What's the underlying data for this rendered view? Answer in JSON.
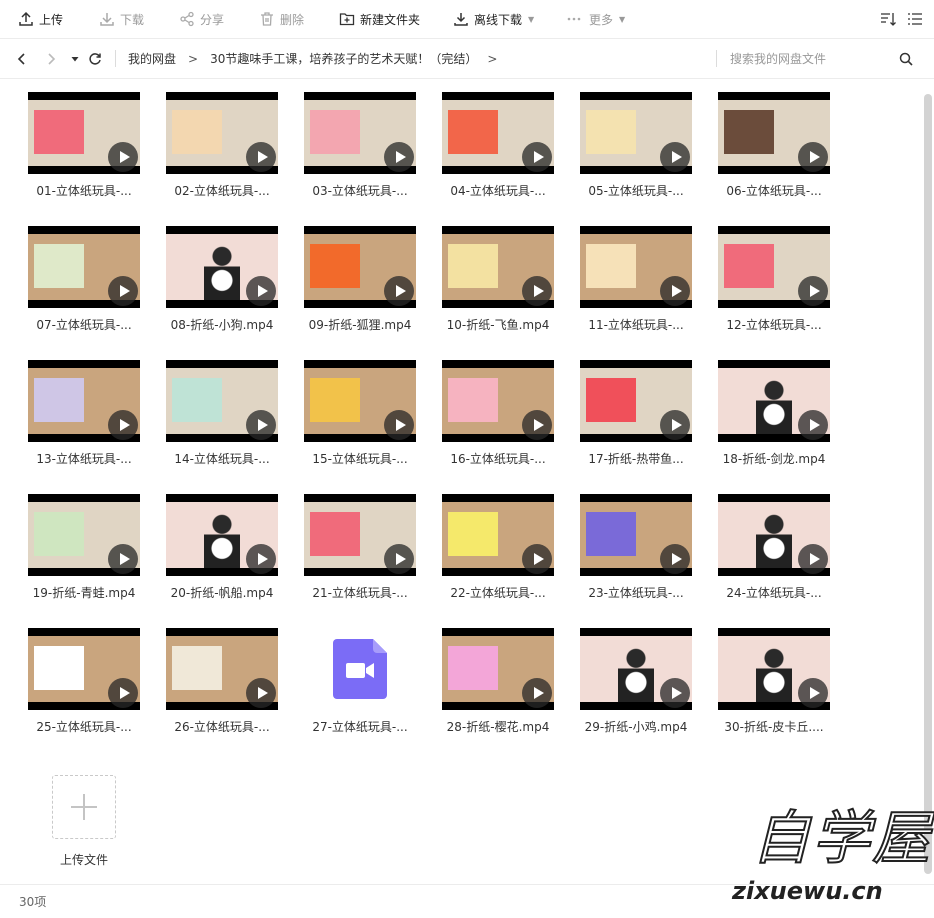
{
  "toolbar": {
    "upload": "上传",
    "download": "下载",
    "share": "分享",
    "delete": "删除",
    "new_folder": "新建文件夹",
    "offline_download": "离线下载",
    "more": "更多"
  },
  "nav": {
    "root": "我的网盘",
    "folder": "30节趣味手工课，培养孩子的艺术天赋！（完结）",
    "search_placeholder": "搜索我的网盘文件"
  },
  "files": [
    {
      "name": "01-立体纸玩具-..."
    },
    {
      "name": "02-立体纸玩具-..."
    },
    {
      "name": "03-立体纸玩具-..."
    },
    {
      "name": "04-立体纸玩具-..."
    },
    {
      "name": "05-立体纸玩具-..."
    },
    {
      "name": "06-立体纸玩具-..."
    },
    {
      "name": "07-立体纸玩具-..."
    },
    {
      "name": "08-折纸-小狗.mp4"
    },
    {
      "name": "09-折纸-狐狸.mp4"
    },
    {
      "name": "10-折纸-飞鱼.mp4"
    },
    {
      "name": "11-立体纸玩具-..."
    },
    {
      "name": "12-立体纸玩具-..."
    },
    {
      "name": "13-立体纸玩具-..."
    },
    {
      "name": "14-立体纸玩具-..."
    },
    {
      "name": "15-立体纸玩具-..."
    },
    {
      "name": "16-立体纸玩具-..."
    },
    {
      "name": "17-折纸-热带鱼..."
    },
    {
      "name": "18-折纸-剑龙.mp4"
    },
    {
      "name": "19-折纸-青蛙.mp4"
    },
    {
      "name": "20-折纸-帆船.mp4"
    },
    {
      "name": "21-立体纸玩具-..."
    },
    {
      "name": "22-立体纸玩具-..."
    },
    {
      "name": "23-立体纸玩具-..."
    },
    {
      "name": "24-立体纸玩具-..."
    },
    {
      "name": "25-立体纸玩具-..."
    },
    {
      "name": "26-立体纸玩具-..."
    },
    {
      "name": "27-立体纸玩具-..."
    },
    {
      "name": "28-折纸-樱花.mp4"
    },
    {
      "name": "29-折纸-小鸡.mp4"
    },
    {
      "name": "30-折纸-皮卡丘...."
    }
  ],
  "upload_tile": {
    "label": "上传文件"
  },
  "status": {
    "count": "30项"
  },
  "watermark": {
    "logo": "自学屋",
    "url": "zixuewu.cn"
  },
  "colors": {
    "accent": "#7b6cf6",
    "thumb_bar": "#000000",
    "table_wood": "#d9b58c"
  }
}
